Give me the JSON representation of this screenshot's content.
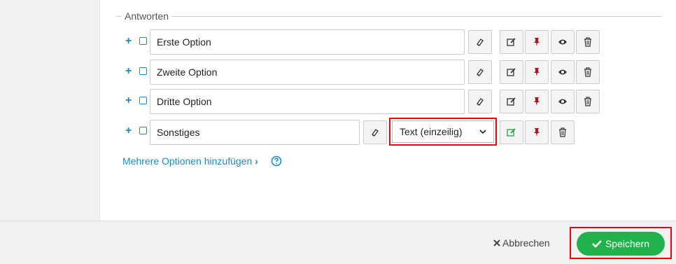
{
  "fieldset": {
    "legend": "Antworten"
  },
  "options": [
    {
      "label": "Erste Option"
    },
    {
      "label": "Zweite Option"
    },
    {
      "label": "Dritte Option"
    },
    {
      "label": "Sonstiges",
      "type_value": "Text (einzeilig)"
    }
  ],
  "add_more": {
    "label": "Mehrere Optionen hinzufügen",
    "chevron": "›"
  },
  "footer": {
    "cancel_label": "Abbrechen",
    "save_label": "Speichern"
  },
  "icons": {
    "add": "plus-icon",
    "checkbox": "checkbox-icon",
    "clear": "eraser-icon",
    "edit": "edit-icon",
    "pin": "pin-icon",
    "visibility": "eye-icon",
    "delete": "trash-icon",
    "help": "question-circle-icon",
    "cancel": "times-icon",
    "save": "check-icon"
  },
  "colors": {
    "link": "#1a8bc1",
    "pin": "#b5121b",
    "save": "#21b24b",
    "highlight": "#e00000",
    "edit_active": "#2a9a3f"
  }
}
